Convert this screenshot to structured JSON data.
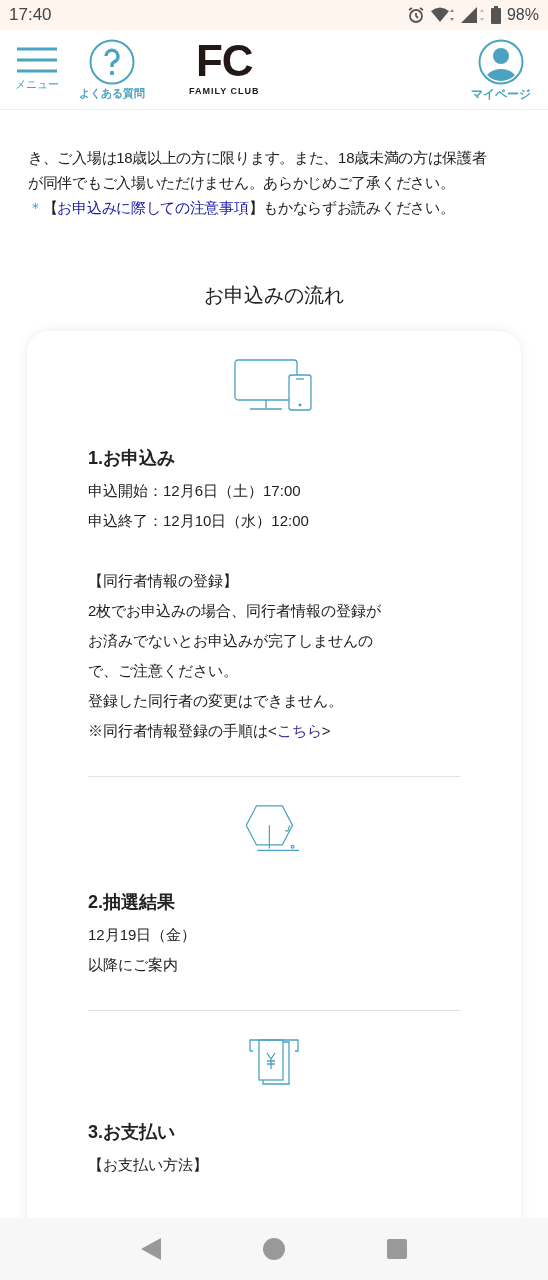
{
  "status_bar": {
    "time": "17:40",
    "battery": "98%"
  },
  "header": {
    "menu_label": "メニュー",
    "faq_label": "よくある質問",
    "logo_mark": "FC",
    "logo_text": "FAMILY CLUB",
    "mypage_label": "マイページ"
  },
  "notice": {
    "lines": [
      "き、ご入場は18歳以上の方に限ります。また、18歳未満の方は保護者",
      "が同伴でもご入場いただけません。あらかじめご了承ください。"
    ],
    "note": {
      "mark": "＊",
      "open": "【",
      "link": "お申込みに際しての注意事項",
      "rest": "】もかならずお読みください。"
    }
  },
  "flow": {
    "title": "お申込みの流れ",
    "steps": [
      {
        "heading": "1.お申込み",
        "blocks": [
          [
            "申込開始：12月6日（土）17:00",
            "申込終了：12月10日（水）12:00"
          ],
          [
            "【同行者情報の登録】",
            "2枚でお申込みの場合、同行者情報の登録が",
            "お済みでないとお申込みが完了しませんの",
            "で、ご注意ください。",
            "登録した同行者の変更はできません。"
          ]
        ],
        "link_line": {
          "before": "※同行者情報登録の手順は<",
          "link": "こちら",
          "after": ">"
        }
      },
      {
        "heading": "2.抽選結果",
        "blocks": [
          [
            "12月19日（金）",
            "以降にご案内"
          ]
        ]
      },
      {
        "heading": "3.お支払い",
        "blocks": [
          [
            "【お支払い方法】"
          ]
        ]
      }
    ]
  }
}
